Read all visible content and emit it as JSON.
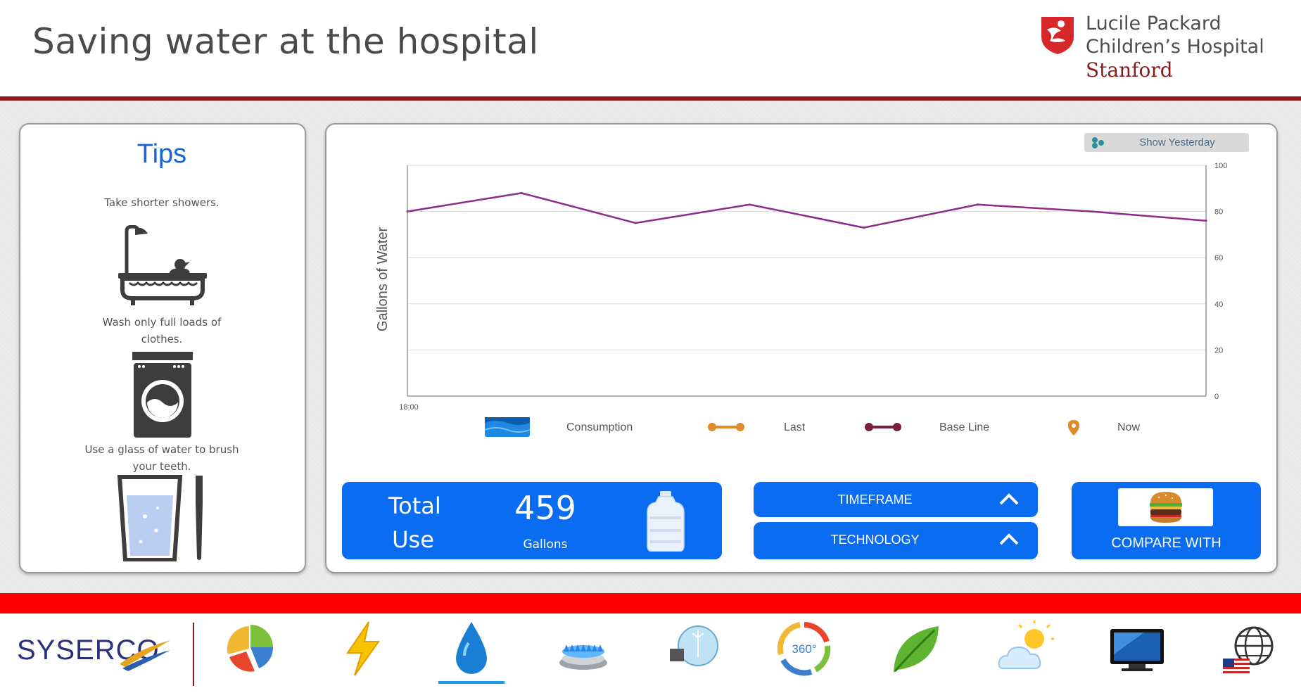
{
  "header": {
    "title": "Saving water at the hospital",
    "logo_lines": [
      "Lucile Packard",
      "Children’s Hospital",
      "Stanford"
    ]
  },
  "tips": {
    "title": "Tips",
    "items": [
      {
        "text": "Take shorter showers.",
        "icon": "bathtub-icon"
      },
      {
        "text": "Wash only full loads of clothes.",
        "icon": "washing-machine-icon"
      },
      {
        "text": "Use a glass of water to brush your teeth.",
        "icon": "glass-toothbrush-icon"
      }
    ]
  },
  "chart_controls": {
    "show_yesterday_label": "Show Yesterday"
  },
  "chart_data": {
    "type": "line",
    "ylabel": "Gallons of Water",
    "xlabel": "",
    "x_ticks": [
      "18:00"
    ],
    "y_ticks": [
      0,
      20,
      40,
      60,
      80,
      100
    ],
    "ylim": [
      0,
      100
    ],
    "grid": true,
    "y_axis_side": "right",
    "series": [
      {
        "name": "Base Line",
        "color": "#8e2a8e",
        "values": [
          80,
          88,
          75,
          83,
          73,
          83,
          80,
          76
        ]
      }
    ],
    "legend": [
      {
        "label": "Consumption",
        "icon": "water-wave-icon",
        "color": "#1e88e5"
      },
      {
        "label": "Last",
        "icon": "line-dot-icon",
        "color": "#e08a2c"
      },
      {
        "label": "Base Line",
        "icon": "line-dot-icon",
        "color": "#7a1f3a"
      },
      {
        "label": "Now",
        "icon": "pin-icon",
        "color": "#e08a2c"
      }
    ],
    "legend_position": "bottom"
  },
  "total_use": {
    "label_line1": "Total",
    "label_line2": "Use",
    "value": "459",
    "unit": "Gallons"
  },
  "buttons": {
    "timeframe": "TIMEFRAME",
    "technology": "TECHNOLOGY",
    "compare_with": "COMPARE WITH"
  },
  "footer": {
    "brand": "SYSERCO",
    "nav_icons": [
      "pie-chart-icon",
      "lightning-icon",
      "water-drop-icon",
      "gas-burner-icon",
      "lightbulb-icon",
      "360-icon",
      "leaf-icon",
      "weather-icon",
      "monitor-icon",
      "globe-icon"
    ],
    "active_icon": "water-drop-icon",
    "nav_360_label": "360°"
  },
  "colors": {
    "accent_blue": "#0a6cf0",
    "header_rule": "#8b1a1a",
    "red_bar": "#ff0000",
    "baseline_line": "#8e2a8e"
  }
}
